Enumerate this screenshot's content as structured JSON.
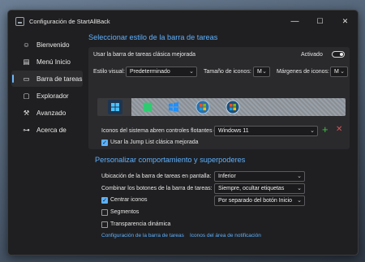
{
  "window": {
    "title": "Configuración de StartAllBack"
  },
  "caption": {
    "minimize": "—",
    "maximize": "☐",
    "close": "✕"
  },
  "sidebar": {
    "items": [
      {
        "label": "Bienvenido",
        "icon": "smiley-icon",
        "glyph": "☺"
      },
      {
        "label": "Menú Inicio",
        "icon": "start-menu-icon",
        "glyph": "▤"
      },
      {
        "label": "Barra de tareas",
        "icon": "taskbar-icon",
        "glyph": "▭"
      },
      {
        "label": "Explorador",
        "icon": "folder-icon",
        "glyph": "▢"
      },
      {
        "label": "Avanzado",
        "icon": "wrench-icon",
        "glyph": "⚒"
      },
      {
        "label": "Acerca de",
        "icon": "about-icon",
        "glyph": "⊶"
      }
    ],
    "active_index": 2
  },
  "taskbar_section": {
    "title": "Seleccionar estilo de la barra de tareas",
    "classic_label": "Usar la barra de tareas clásica mejorada",
    "toggle_state": "Activado",
    "visual_style_label": "Estilo visual:",
    "visual_style_value": "Predeterminado",
    "icon_size_label": "Tamaño de iconos:",
    "icon_size_value": "M",
    "margins_label": "Márgenes de iconos:",
    "margins_value": "M",
    "flyout_label": "Iconos del sistema abren controles flotantes de:",
    "flyout_value": "Windows 11",
    "add_symbol": "+",
    "remove_symbol": "✕",
    "jumplist_label": "Usar la Jump List clásica mejorada",
    "jumplist_checked": true
  },
  "behavior_section": {
    "title": "Personalizar comportamiento y superpoderes",
    "location_label": "Ubicación de la barra de tareas en pantalla:",
    "location_value": "Inferior",
    "combine_label": "Combinar los botones de la barra de tareas:",
    "combine_value": "Siempre, ocultar etiquetas",
    "center_label": "Centrar iconos",
    "center_checked": true,
    "center_value": "Por separado del botón Inicio",
    "segments_label": "Segmentos",
    "segments_checked": false,
    "transparency_label": "Transparencia dinámica",
    "transparency_checked": false
  },
  "links": {
    "taskbar_config": "Configuración de la barra de tareas",
    "notification_icons": "Iconos del área de notificación"
  },
  "colors": {
    "accent": "#5db1ff",
    "background": "#1f1f21",
    "add": "#3fbf3f",
    "remove": "#e05050"
  }
}
